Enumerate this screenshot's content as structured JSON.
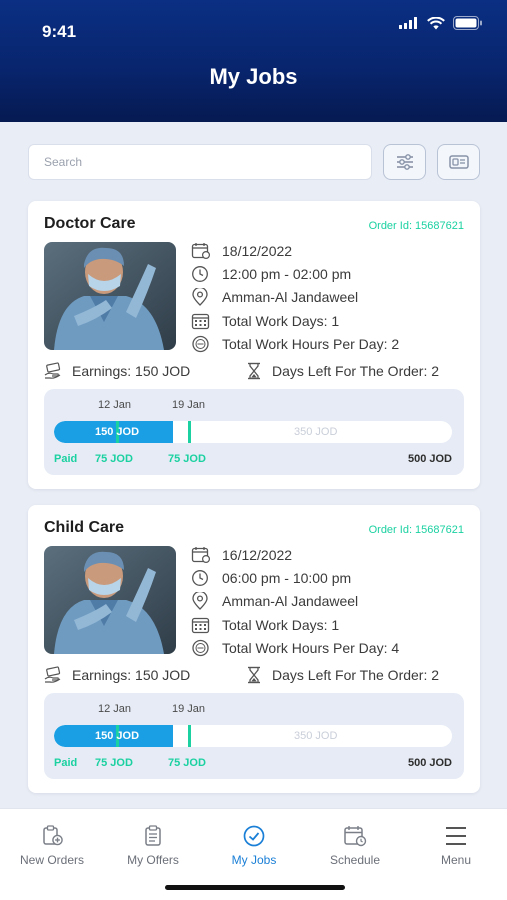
{
  "status_bar": {
    "time": "9:41"
  },
  "header": {
    "title": "My Jobs"
  },
  "search": {
    "placeholder": "Search"
  },
  "toolbar": {
    "filter_icon": "sliders-icon",
    "second_icon": "id-card-icon"
  },
  "colors": {
    "header": "#08256e",
    "accent_green": "#1bd1a1",
    "progress_blue": "#1a9fe4",
    "active_tab": "#1a7fd6"
  },
  "jobs": [
    {
      "title": "Doctor Care",
      "order_id": "Order Id: 15687621",
      "date": "18/12/2022",
      "time": "12:00 pm - 02:00 pm",
      "location": "Amman-Al Jandaweel",
      "work_days": "Total Work Days: 1",
      "work_hours": "Total Work Hours Per Day: 2",
      "earnings": "Earnings: 150 JOD",
      "days_left": "Days Left For The Order: 2",
      "progress": {
        "date1": "12 Jan",
        "date2": "19 Jan",
        "paid_amount": "150 JOD",
        "remaining_amount": "350 JOD",
        "paid_fraction": 0.3,
        "paid_label": "Paid",
        "installment1": "75 JOD",
        "installment2": "75 JOD",
        "total": "500 JOD"
      }
    },
    {
      "title": "Child Care",
      "order_id": "Order Id: 15687621",
      "date": "16/12/2022",
      "time": "06:00 pm - 10:00 pm",
      "location": "Amman-Al Jandaweel",
      "work_days": "Total Work Days: 1",
      "work_hours": "Total Work Hours Per Day: 4",
      "earnings": "Earnings: 150 JOD",
      "days_left": "Days Left For The Order: 2",
      "progress": {
        "date1": "12 Jan",
        "date2": "19 Jan",
        "paid_amount": "150 JOD",
        "remaining_amount": "350 JOD",
        "paid_fraction": 0.3,
        "paid_label": "Paid",
        "installment1": "75 JOD",
        "installment2": "75 JOD",
        "total": "500 JOD"
      }
    }
  ],
  "tabs": [
    {
      "label": "New Orders",
      "icon": "new-orders-icon",
      "active": false
    },
    {
      "label": "My Offers",
      "icon": "clipboard-icon",
      "active": false
    },
    {
      "label": "My Jobs",
      "icon": "check-circle-icon",
      "active": true
    },
    {
      "label": "Schedule",
      "icon": "calendar-clock-icon",
      "active": false
    },
    {
      "label": "Menu",
      "icon": "hamburger-menu-icon",
      "active": false
    }
  ]
}
